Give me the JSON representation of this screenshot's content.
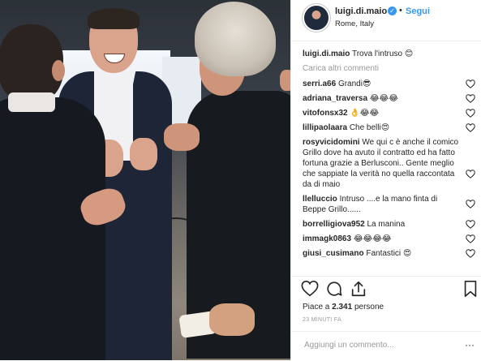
{
  "header": {
    "username": "luigi.di.maio",
    "separator": "•",
    "follow_label": "Segui",
    "location": "Rome, Italy"
  },
  "caption": {
    "username": "luigi.di.maio",
    "text": "Trova l'intruso 😊"
  },
  "load_more_label": "Carica altri commenti",
  "comments": [
    {
      "username": "serri.a66",
      "text": "Grandi😎"
    },
    {
      "username": "adriana_traversa",
      "text": "😂😂😂"
    },
    {
      "username": "vitofonsx32",
      "text": "👌😂😂"
    },
    {
      "username": "lillipaolaara",
      "text": "Che belli😍"
    },
    {
      "username": "rosyvicidomini",
      "text": "We qui c è anche il comico Grillo dove ha avuto il contratto ed ha fatto fortuna grazie a Berlusconi.. Gente meglio che sappiate la verità no quella raccontata da di maio"
    },
    {
      "username": "llelluccio",
      "text": "Intruso ....e la mano finta di Beppe Grillo......"
    },
    {
      "username": "borrelligiova952",
      "text": "La manina"
    },
    {
      "username": "immagk0863",
      "text": "😂😂😂😂"
    },
    {
      "username": "giusi_cusimano",
      "text": "Fantastici 😍"
    }
  ],
  "likes": {
    "prefix": "Piace a",
    "count": "2.341",
    "suffix": "persone"
  },
  "timestamp": "23 MINUTI FA",
  "add_comment": {
    "placeholder": "Aggiungi un commento...",
    "more": "···"
  },
  "colors": {
    "link_blue": "#3897f0",
    "text": "#262626",
    "muted": "#999999",
    "divider": "#efefef"
  },
  "icons": {
    "verified": "verified-badge-icon",
    "heart": "heart-icon",
    "comment": "comment-bubble-icon",
    "share": "share-icon",
    "bookmark": "bookmark-icon"
  }
}
